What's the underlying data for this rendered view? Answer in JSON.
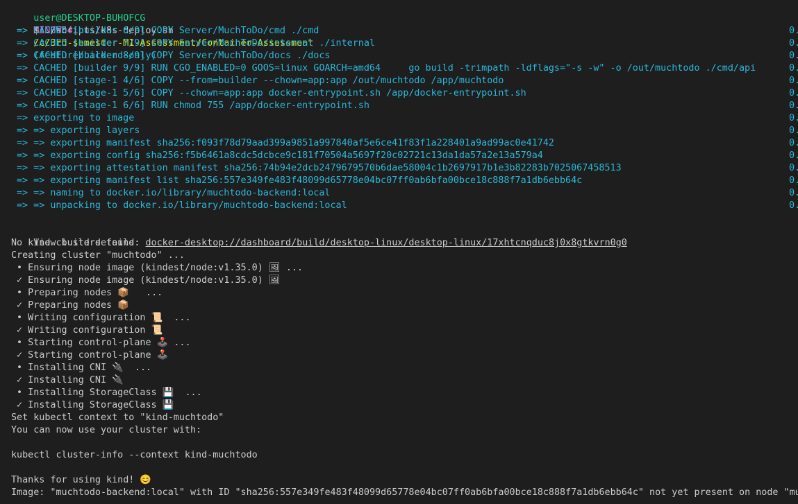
{
  "prompt": {
    "user": "user@DESKTOP-BUHOFCG",
    "shell": "MINGW64",
    "path": "/c/3rd-semester-M1-Assessment/Container-Assessment",
    "branch": "(feature/backend-only)",
    "symbol": "$",
    "command": "./scripts/k8s-deploy.sh"
  },
  "build_lines": [
    {
      "text": "=> CACHED [builder 6/9] COPY Server/MuchToDo/cmd ./cmd",
      "trail": "0."
    },
    {
      "text": "=> CACHED [builder 7/9] COPY Server/MuchToDo/internal ./internal",
      "trail": "0."
    },
    {
      "text": "=> CACHED [builder 8/9] COPY Server/MuchToDo/docs ./docs",
      "trail": "0."
    },
    {
      "text": "=> CACHED [builder 9/9] RUN CGO_ENABLED=0 GOOS=linux GOARCH=amd64     go build -trimpath -ldflags=\"-s -w\" -o /out/muchtodo ./cmd/api",
      "trail": "0."
    },
    {
      "text": "=> CACHED [stage-1 4/6] COPY --from=builder --chown=app:app /out/muchtodo /app/muchtodo",
      "trail": "0."
    },
    {
      "text": "=> CACHED [stage-1 5/6] COPY --chown=app:app docker-entrypoint.sh /app/docker-entrypoint.sh",
      "trail": "0."
    },
    {
      "text": "=> CACHED [stage-1 6/6] RUN chmod 755 /app/docker-entrypoint.sh",
      "trail": "0."
    },
    {
      "text": "=> exporting to image",
      "trail": "0."
    },
    {
      "text": "=> => exporting layers",
      "trail": "0."
    },
    {
      "text": "=> => exporting manifest sha256:f093f78d79aad399a9851a997840af5e6ce41f83f1a228401a9ad99ac0e41742",
      "trail": "0."
    },
    {
      "text": "=> => exporting config sha256:f5b6461a8cdc5dcbce9c181f70504a5697f20c02721c13da1da57a2e13a579a4",
      "trail": "0."
    },
    {
      "text": "=> => exporting attestation manifest sha256:74b94e2dcb2479679570b6dae58004c1b2697917b1e3b82283b7025067458513",
      "trail": "0."
    },
    {
      "text": "=> => exporting manifest list sha256:557e349fe483f48099d65778e04bc07ff0ab6bfa00bce18c888f7a1db6ebb64c",
      "trail": "0."
    },
    {
      "text": "=> => naming to docker.io/library/muchtodo-backend:local",
      "trail": "0."
    },
    {
      "text": "=> => unpacking to docker.io/library/muchtodo-backend:local",
      "trail": "0."
    }
  ],
  "details": {
    "label": "View build details: ",
    "link": "docker-desktop://dashboard/build/desktop-linux/desktop-linux/17xhtcnqduc8j0x8gtkvrn0g0"
  },
  "kind_lines": [
    "No kind clusters found.",
    "Creating cluster \"muchtodo\" ...",
    " • Ensuring node image (kindest/node:v1.35.0) 🖼 ...",
    " ✓ Ensuring node image (kindest/node:v1.35.0) 🖼",
    " • Preparing nodes 📦   ...",
    " ✓ Preparing nodes 📦",
    " • Writing configuration 📜  ...",
    " ✓ Writing configuration 📜",
    " • Starting control-plane 🕹️ ...",
    " ✓ Starting control-plane 🕹️",
    " • Installing CNI 🔌  ...",
    " ✓ Installing CNI 🔌",
    " • Installing StorageClass 💾  ...",
    " ✓ Installing StorageClass 💾",
    "Set kubectl context to \"kind-muchtodo\"",
    "You can now use your cluster with:",
    "",
    "kubectl cluster-info --context kind-muchtodo",
    "",
    "Thanks for using kind! 😊",
    "Image: \"muchtodo-backend:local\" with ID \"sha256:557e349fe483f48099d65778e04bc07ff0ab6bfa00bce18c888f7a1db6ebb64c\" not yet present on node \"muchtodo-control-plane\", loading..."
  ]
}
